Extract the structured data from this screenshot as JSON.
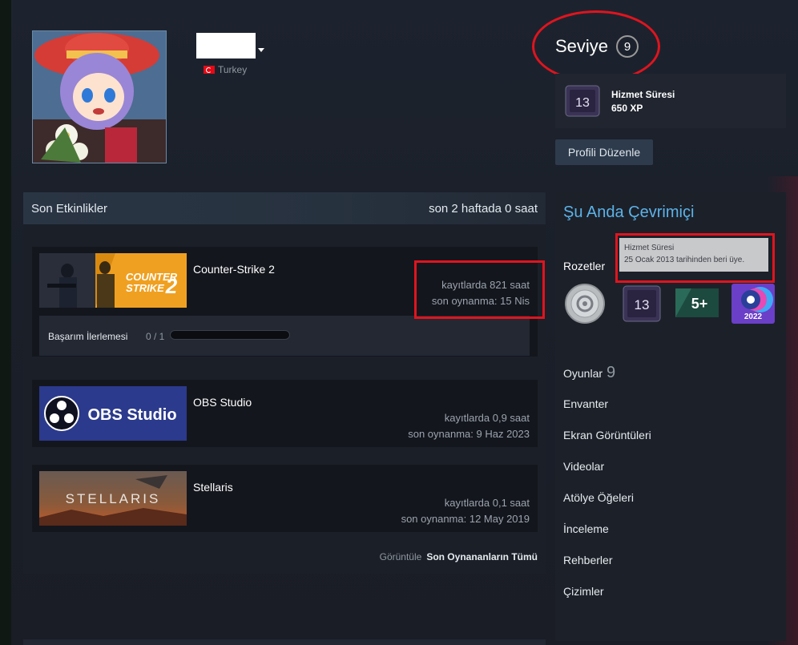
{
  "profile": {
    "country": "Turkey"
  },
  "level": {
    "label": "Seviye",
    "value": "9"
  },
  "xp": {
    "badge_number": "13",
    "title": "Hizmet Süresi",
    "value": "650 XP"
  },
  "edit_profile": "Profili Düzenle",
  "recent": {
    "title": "Son Etkinlikler",
    "hours": "son 2 haftada 0 saat",
    "games": [
      {
        "name": "Counter-Strike 2",
        "image_text": "COUNTER STRIKE 2",
        "hours": "kayıtlarda 821 saat",
        "last": "son oynanma: 15 Nis",
        "achievement_label": "Başarım İlerlemesi",
        "achievement_count": "0 / 1"
      },
      {
        "name": "OBS Studio",
        "image_text": "OBS Studio",
        "hours": "kayıtlarda 0,9 saat",
        "last": "son oynanma: 9 Haz 2023"
      },
      {
        "name": "Stellaris",
        "image_text": "STELLARIS",
        "hours": "kayıtlarda 0,1 saat",
        "last": "son oynanma: 12 May 2019"
      }
    ],
    "view_prefix": "Görüntüle",
    "view_all": "Son Oynananların Tümü"
  },
  "sidebar": {
    "online": "Şu Anda Çevrimiçi",
    "badges_label": "Rozetler",
    "badges": [
      {
        "icon": "steam-coin-badge-icon"
      },
      {
        "icon": "years-of-service-badge-icon",
        "text": "13"
      },
      {
        "icon": "five-plus-badge-icon",
        "text": "5+"
      },
      {
        "icon": "steam-2022-badge-icon",
        "text": "2022"
      }
    ],
    "games_label": "Oyunlar",
    "games_count": "9",
    "links": [
      "Envanter",
      "Ekran Görüntüleri",
      "Videolar",
      "Atölye Öğeleri",
      "İnceleme",
      "Rehberler",
      "Çizimler"
    ]
  },
  "tooltip": {
    "title": "Hizmet Süresi",
    "text": "25 Ocak 2013 tarihinden beri üye."
  },
  "colors": {
    "accent_blue": "#5cb3e8",
    "highlight_red": "#e0141e",
    "cs2_orange": "#f5a623",
    "obs_blue": "#2b3a8c"
  }
}
